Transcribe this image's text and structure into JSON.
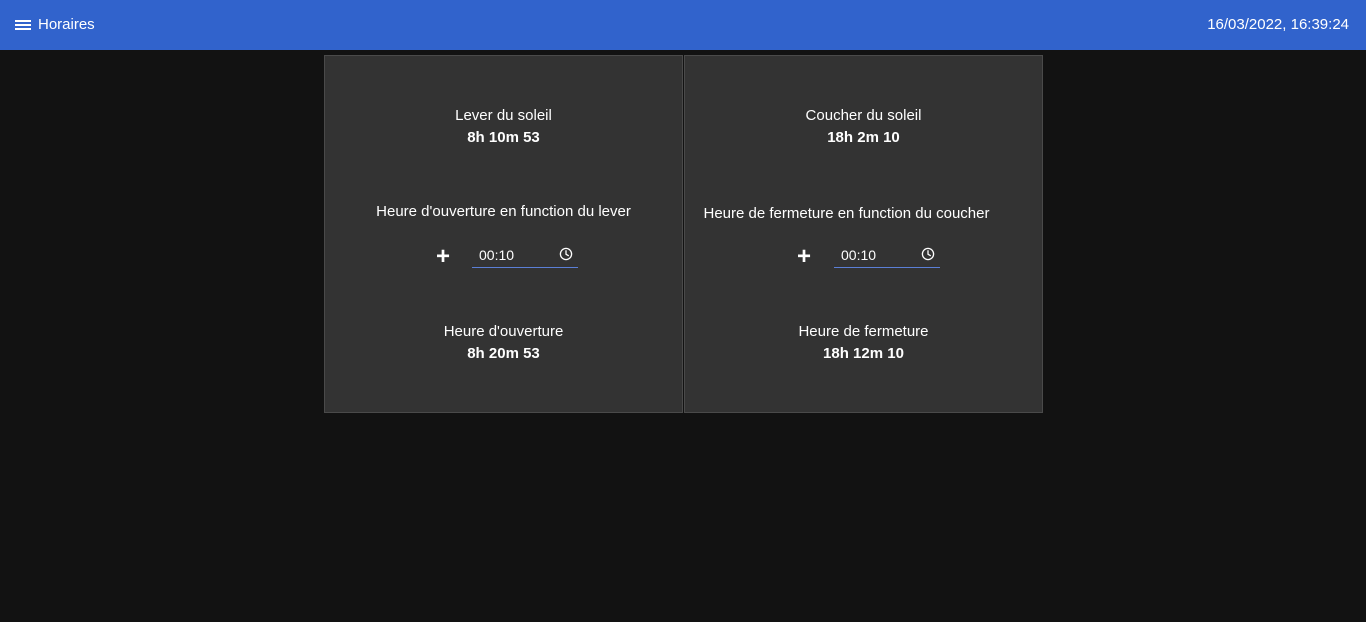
{
  "appbar": {
    "title": "Horaires",
    "datetime": "16/03/2022, 16:39:24",
    "menu_icon": "menu-icon",
    "color": "#3163cc"
  },
  "sunrise_card": {
    "event_label": "Lever du soleil",
    "event_time": "8h 10m 53",
    "offset_label": "Heure d'ouverture en function du lever",
    "offset_prefix": "+",
    "offset_value": "00:10",
    "offset_icon": "clock-icon",
    "result_label": "Heure d'ouverture",
    "result_time": "8h 20m 53"
  },
  "sunset_card": {
    "event_label": "Coucher du soleil",
    "event_time": "18h 2m 10",
    "offset_label": "Heure de fermeture en function du coucher",
    "offset_prefix": "+",
    "offset_value": "00:10",
    "offset_icon": "clock-icon",
    "result_label": "Heure de fermeture",
    "result_time": "18h 12m 10"
  }
}
